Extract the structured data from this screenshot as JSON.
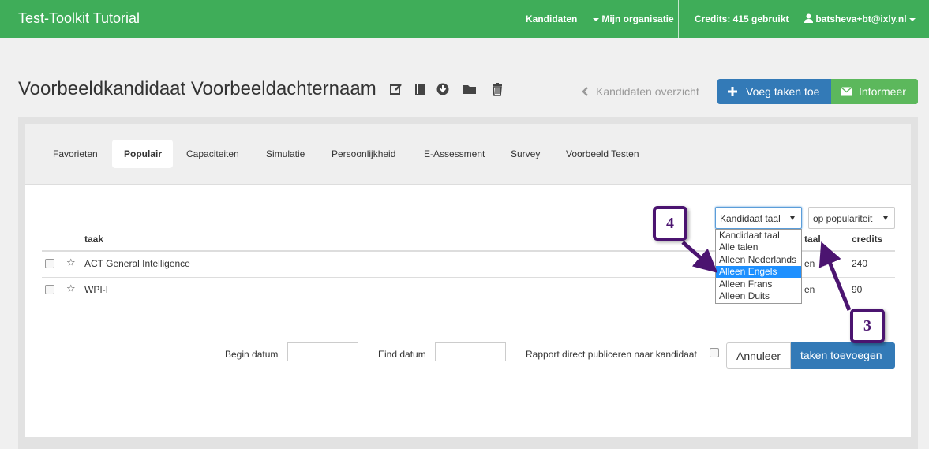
{
  "navbar": {
    "brand": "Test-Toolkit Tutorial",
    "kandidaten": "Kandidaten",
    "organisatie": "Mijn organisatie",
    "credits": "Credits: 415 gebruikt",
    "user": "batsheva+bt@ixly.nl"
  },
  "header": {
    "title": "Voorbeeldkandidaat Voorbeeldachternaam",
    "back_link": "Kandidaten overzicht",
    "add_tasks": "Voeg taken toe",
    "inform": "Informeer"
  },
  "tabs": [
    "Favorieten",
    "Populair",
    "Capaciteiten",
    "Simulatie",
    "Persoonlijkheid",
    "E-Assessment",
    "Survey",
    "Voorbeeld Testen"
  ],
  "active_tab": "Populair",
  "filters": {
    "language": "Kandidaat taal",
    "sort": "op populariteit",
    "language_options": [
      "Kandidaat taal",
      "Alle talen",
      "Alleen Nederlands",
      "Alleen Engels",
      "Alleen Frans",
      "Alleen Duits"
    ],
    "highlighted_option": "Alleen Engels"
  },
  "table": {
    "headers": {
      "task": "taak",
      "lang": "taal",
      "credits": "credits"
    },
    "rows": [
      {
        "name": "ACT General Intelligence",
        "lang": "en",
        "credits": "240"
      },
      {
        "name": "WPI-I",
        "lang": "en",
        "credits": "90"
      }
    ]
  },
  "footer": {
    "begin_label": "Begin datum",
    "end_label": "Eind datum",
    "publish_label": "Rapport direct publiceren naar kandidaat",
    "cancel": "Annuleer",
    "submit": "taken toevoegen"
  },
  "annotations": {
    "step4": "4",
    "step3": "3"
  },
  "colors": {
    "navbar": "#3fad59",
    "primary": "#337ab7",
    "success": "#5cb85c",
    "annotation": "#4b1470",
    "highlight": "#1e90ff"
  }
}
